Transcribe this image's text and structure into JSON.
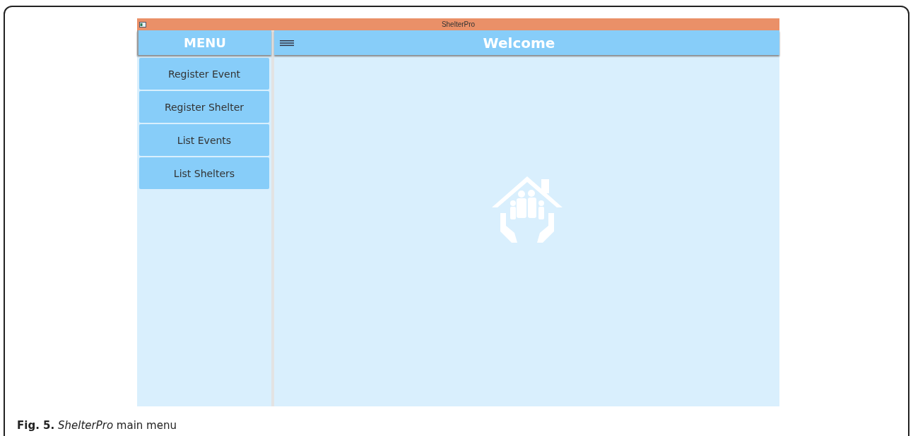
{
  "window": {
    "title": "ShelterPro"
  },
  "sidebar": {
    "header": "MENU",
    "items": [
      {
        "label": "Register Event"
      },
      {
        "label": "Register Shelter"
      },
      {
        "label": "List Events"
      },
      {
        "label": "List Shelters"
      }
    ]
  },
  "main": {
    "title": "Welcome"
  },
  "caption": "**Fig. 5.** *ShelterPro* main menu"
}
